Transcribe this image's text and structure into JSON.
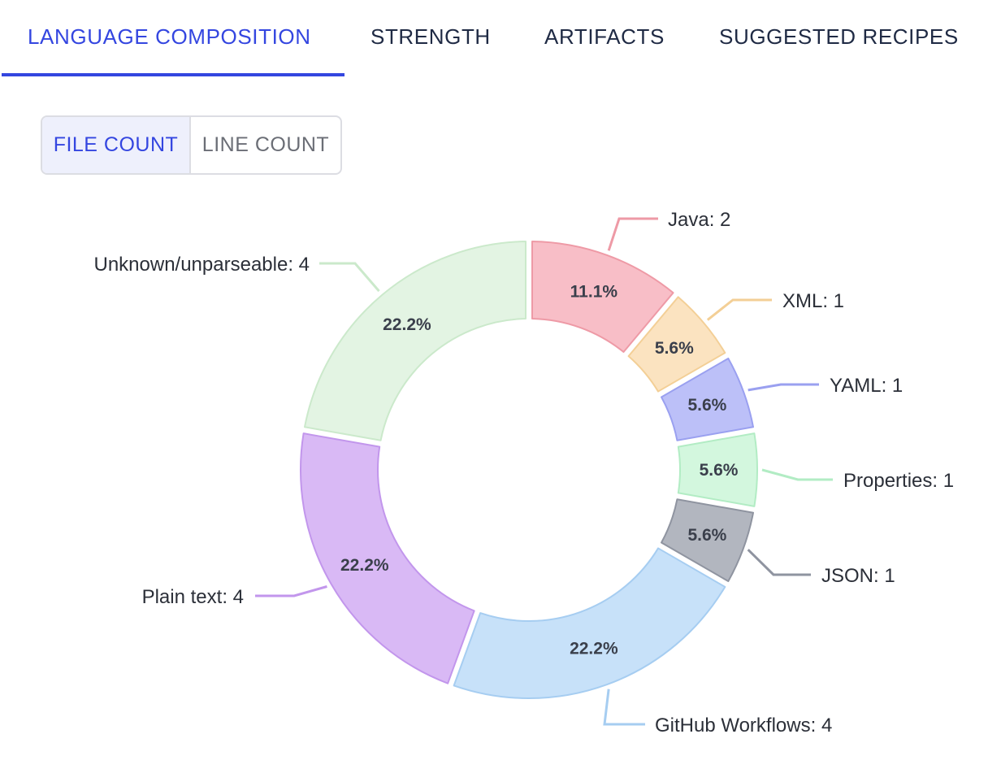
{
  "tabs": [
    {
      "label": "LANGUAGE COMPOSITION",
      "active": true
    },
    {
      "label": "STRENGTH",
      "active": false
    },
    {
      "label": "ARTIFACTS",
      "active": false
    },
    {
      "label": "SUGGESTED RECIPES",
      "active": false
    }
  ],
  "count_toggle": {
    "file_count": "FILE COUNT",
    "line_count": "LINE COUNT",
    "selected": "FILE COUNT"
  },
  "chart_data": {
    "type": "pie",
    "style": "donut",
    "title": "",
    "slices": [
      {
        "name": "Java",
        "value": 2,
        "percent": "11.1%",
        "label": "Java: 2",
        "color": "#f8bec7",
        "stroke": "#ee9aa6"
      },
      {
        "name": "XML",
        "value": 1,
        "percent": "5.6%",
        "label": "XML: 1",
        "color": "#fbe3c0",
        "stroke": "#f3cf96"
      },
      {
        "name": "YAML",
        "value": 1,
        "percent": "5.6%",
        "label": "YAML: 1",
        "color": "#bcc0f8",
        "stroke": "#9aa0f0"
      },
      {
        "name": "Properties",
        "value": 1,
        "percent": "5.6%",
        "label": "Properties: 1",
        "color": "#d3f7de",
        "stroke": "#b2ecc4"
      },
      {
        "name": "JSON",
        "value": 1,
        "percent": "5.6%",
        "label": "JSON: 1",
        "color": "#b2b6bf",
        "stroke": "#8f94a0"
      },
      {
        "name": "GitHub Workflows",
        "value": 4,
        "percent": "22.2%",
        "label": "GitHub Workflows: 4",
        "color": "#c7e1f9",
        "stroke": "#a6cdf1"
      },
      {
        "name": "Plain text",
        "value": 4,
        "percent": "22.2%",
        "label": "Plain text: 4",
        "color": "#d9b9f5",
        "stroke": "#c296ec"
      },
      {
        "name": "Unknown/unparseable",
        "value": 4,
        "percent": "22.2%",
        "label": "Unknown/unparseable: 4",
        "color": "#e3f4e3",
        "stroke": "#cbe9cb"
      }
    ]
  }
}
